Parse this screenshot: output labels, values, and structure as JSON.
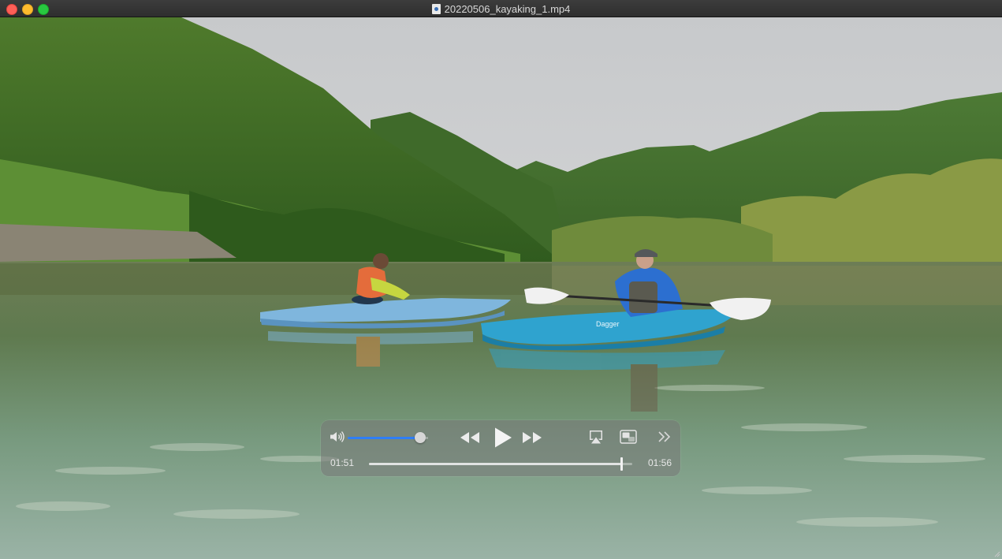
{
  "window": {
    "title": "20220506_kayaking_1.mp4",
    "file_icon": "movie-document-icon"
  },
  "controls": {
    "volume_level": 0.9,
    "current_time": "01:51",
    "duration": "01:56",
    "progress": 0.957,
    "icons": {
      "volume": "speaker-volume-icon",
      "rewind": "rewind-icon",
      "play": "play-icon",
      "fast_forward": "fast-forward-icon",
      "airplay": "airplay-icon",
      "pip": "picture-in-picture-icon",
      "more": "chevron-double-right-icon"
    }
  },
  "colors": {
    "accent": "#2f7ef6",
    "close": "#fe5f57",
    "minimize": "#febc2e",
    "maximize": "#28c840"
  }
}
